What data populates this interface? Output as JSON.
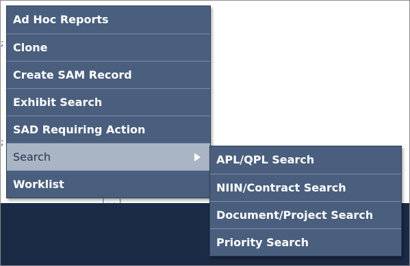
{
  "menu": {
    "items": [
      {
        "label": "Ad Hoc Reports"
      },
      {
        "label": "Clone"
      },
      {
        "label": "Create SAM Record"
      },
      {
        "label": "Exhibit Search"
      },
      {
        "label": "SAD Requiring Action"
      },
      {
        "label": "Search",
        "active": true,
        "has_submenu": true
      },
      {
        "label": "Worklist"
      }
    ]
  },
  "submenu": {
    "items": [
      {
        "label": "APL/QPL Search"
      },
      {
        "label": "NIIN/Contract Search"
      },
      {
        "label": "Document/Project Search"
      },
      {
        "label": "Priority Search"
      }
    ]
  },
  "background": {
    "fragment_text": "( . . )"
  },
  "colors": {
    "menu_bg": "#4a5f7d",
    "menu_active_bg": "#a9b5c5",
    "menu_text": "#ffffff",
    "footer_band": "#1b2a45"
  }
}
